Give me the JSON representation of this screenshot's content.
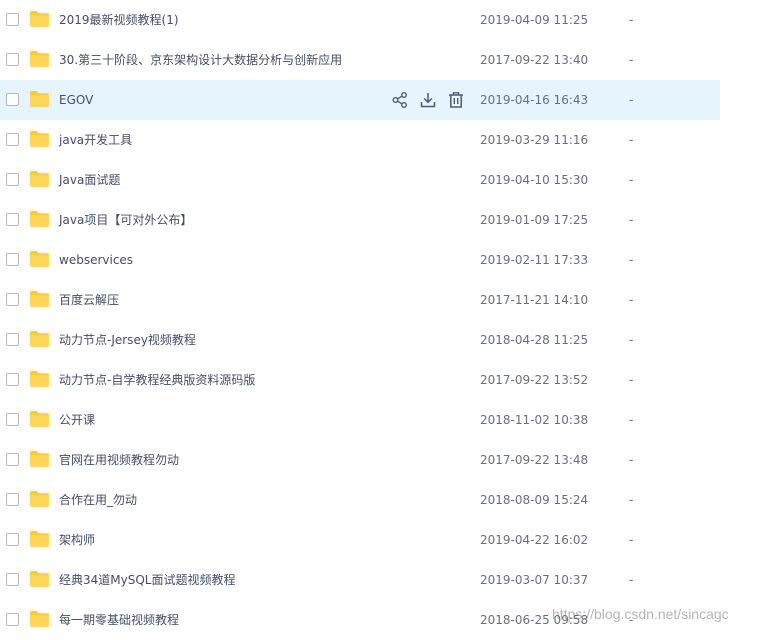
{
  "file_list": {
    "rows": [
      {
        "name": "2019最新视频教程(1)",
        "modified": "2019-04-09 11:25",
        "size": "-"
      },
      {
        "name": "30.第三十阶段、京东架构设计大数据分析与创新应用",
        "modified": "2017-09-22 13:40",
        "size": "-"
      },
      {
        "name": "EGOV",
        "modified": "2019-04-16 16:43",
        "size": "-"
      },
      {
        "name": "java开发工具",
        "modified": "2019-03-29 11:16",
        "size": "-"
      },
      {
        "name": "Java面试题",
        "modified": "2019-04-10 15:30",
        "size": "-"
      },
      {
        "name": "Java项目【可对外公布】",
        "modified": "2019-01-09 17:25",
        "size": "-"
      },
      {
        "name": "webservices",
        "modified": "2019-02-11 17:33",
        "size": "-"
      },
      {
        "name": "百度云解压",
        "modified": "2017-11-21 14:10",
        "size": "-"
      },
      {
        "name": "动力节点-Jersey视频教程",
        "modified": "2018-04-28 11:25",
        "size": "-"
      },
      {
        "name": "动力节点-自学教程经典版资料源码版",
        "modified": "2017-09-22 13:52",
        "size": "-"
      },
      {
        "name": "公开课",
        "modified": "2018-11-02 10:38",
        "size": "-"
      },
      {
        "name": "官网在用视频教程勿动",
        "modified": "2017-09-22 13:48",
        "size": "-"
      },
      {
        "name": "合作在用_勿动",
        "modified": "2018-08-09 15:24",
        "size": "-"
      },
      {
        "name": "架构师",
        "modified": "2019-04-22 16:02",
        "size": "-"
      },
      {
        "name": "经典34道MySQL面试题视频教程",
        "modified": "2019-03-07 10:37",
        "size": "-"
      },
      {
        "name": "每一期零基础视频教程",
        "modified": "2018-06-25 09:58",
        "size": "-"
      }
    ],
    "hovered_row": 2,
    "row_action_icons": [
      "share-icon",
      "download-icon",
      "delete-icon"
    ]
  },
  "watermark": "https://blog.csdn.net/sincagc",
  "colors": {
    "folder": "#ffc93c",
    "hover_row_bg": "#e5f4fd",
    "text": "#424e67",
    "icon": "#4c5b75"
  }
}
